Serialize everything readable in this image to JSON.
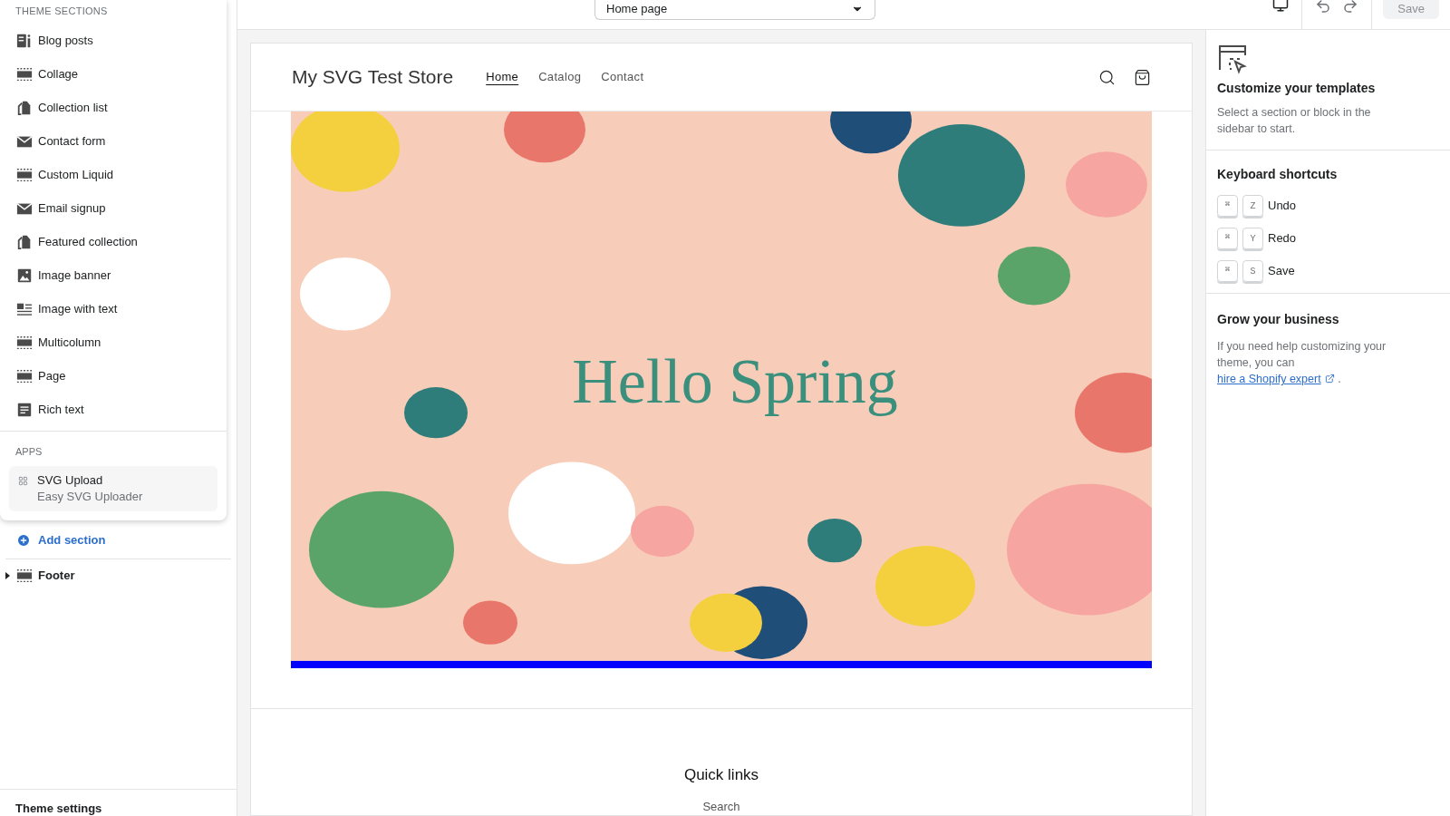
{
  "sidebar": {
    "popup": {
      "heading": "THEME SECTIONS",
      "items": [
        {
          "label": "Blog posts",
          "kind": "blog"
        },
        {
          "label": "Collage",
          "kind": "dashed"
        },
        {
          "label": "Collection list",
          "kind": "tag"
        },
        {
          "label": "Contact form",
          "kind": "mail"
        },
        {
          "label": "Custom Liquid",
          "kind": "dashed"
        },
        {
          "label": "Email signup",
          "kind": "mail"
        },
        {
          "label": "Featured collection",
          "kind": "tag"
        },
        {
          "label": "Image banner",
          "kind": "image"
        },
        {
          "label": "Image with text",
          "kind": "imagetext"
        },
        {
          "label": "Multicolumn",
          "kind": "dashed"
        },
        {
          "label": "Page",
          "kind": "dashed"
        },
        {
          "label": "Rich text",
          "kind": "text"
        }
      ],
      "apps_heading": "APPS",
      "apps": [
        {
          "name": "SVG Upload",
          "subtitle": "Easy SVG Uploader"
        }
      ]
    },
    "add_section": "Add section",
    "footer_group": {
      "label": "Footer",
      "expanded": false
    },
    "theme_settings": "Theme settings"
  },
  "topbar": {
    "page_select": "Home page",
    "save": {
      "label": "Save",
      "disabled": true
    }
  },
  "preview": {
    "store_name": "My SVG Test Store",
    "nav": [
      {
        "label": "Home",
        "selected": true
      },
      {
        "label": "Catalog",
        "selected": false
      },
      {
        "label": "Contact",
        "selected": false
      }
    ],
    "banner_text": "Hello Spring",
    "footer_heading": "Quick links",
    "footer_link": "Search"
  },
  "inspector": {
    "title": "Customize your templates",
    "description": "Select a section or block in the sidebar to start.",
    "shortcuts_title": "Keyboard shortcuts",
    "shortcuts": [
      {
        "modifier": "⌘",
        "key": "Z",
        "action": "Undo"
      },
      {
        "modifier": "⌘",
        "key": "Y",
        "action": "Redo"
      },
      {
        "modifier": "⌘",
        "key": "S",
        "action": "Save"
      }
    ],
    "grow_title": "Grow your business",
    "grow_text": "If you need help customizing your theme, you can ",
    "grow_link": "hire a Shopify expert",
    "grow_end": "."
  }
}
